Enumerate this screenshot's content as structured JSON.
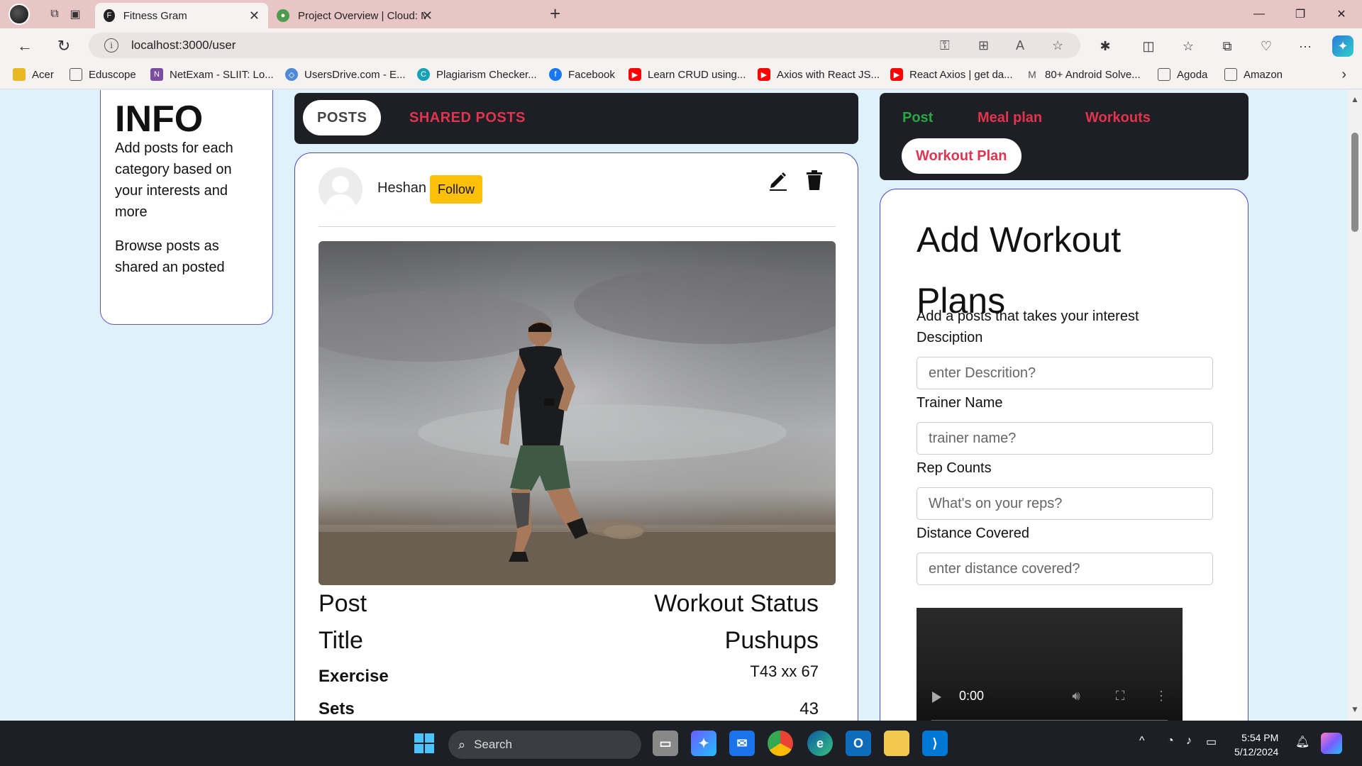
{
  "browser": {
    "tabs": [
      {
        "title": "Fitness Gram",
        "active": true
      },
      {
        "title": "Project Overview | Cloud: Mongo",
        "active": false
      }
    ],
    "url": "localhost:3000/user",
    "bookmarks": [
      {
        "label": "Acer",
        "icon": "folder-icon",
        "color": "#e8b923"
      },
      {
        "label": "Eduscope",
        "icon": "page-icon",
        "color": "#555555"
      },
      {
        "label": "NetExam - SLIIT: Lo...",
        "icon": "netexam-icon",
        "color": "#7b4ea3"
      },
      {
        "label": "UsersDrive.com - E...",
        "icon": "usersdrive-icon",
        "color": "#4e8ad8"
      },
      {
        "label": "Plagiarism Checker...",
        "icon": "plagiarism-icon",
        "color": "#17a2b8"
      },
      {
        "label": "Facebook",
        "icon": "facebook-icon",
        "color": "#1877f2"
      },
      {
        "label": "Learn CRUD using...",
        "icon": "youtube-icon",
        "color": "#ff0000"
      },
      {
        "label": "Axios with React JS...",
        "icon": "youtube-icon",
        "color": "#ff0000"
      },
      {
        "label": "React Axios | get da...",
        "icon": "youtube-icon",
        "color": "#ff0000"
      },
      {
        "label": "80+ Android Solve...",
        "icon": "gmail-icon",
        "color": "#555555"
      },
      {
        "label": "Agoda",
        "icon": "page-icon",
        "color": "#555555"
      },
      {
        "label": "Amazon",
        "icon": "page-icon",
        "color": "#555555"
      }
    ]
  },
  "info": {
    "title": "INFO",
    "p1": "Add posts for each category based on your interests and more",
    "p2": "Browse posts as shared an posted"
  },
  "center_tabs": {
    "posts": "POSTS",
    "shared": "SHARED POSTS"
  },
  "post": {
    "author": "Heshan",
    "follow": "Follow",
    "rows": [
      {
        "left": "Post",
        "right": "Workout Status"
      },
      {
        "left": "Title",
        "right": "Pushups"
      },
      {
        "left": "Exercise",
        "right": "T43 xx 67"
      },
      {
        "left": "Sets",
        "right": "43"
      }
    ]
  },
  "right_tabs": {
    "post": "Post",
    "meal": "Meal plan",
    "workouts": "Workouts",
    "workout_plan": "Workout Plan"
  },
  "form": {
    "title": "Add Workout Plans",
    "subtitle": "Add a posts that takes your interest",
    "fields": [
      {
        "label": "Desciption",
        "placeholder": "enter Descrition?"
      },
      {
        "label": "Trainer Name",
        "placeholder": "trainer name?"
      },
      {
        "label": "Rep Counts",
        "placeholder": "What's on your reps?"
      },
      {
        "label": "Distance Covered",
        "placeholder": "enter distance covered?"
      }
    ],
    "video_time": "0:00"
  },
  "taskbar": {
    "search": "Search",
    "time": "5:54 PM",
    "date": "5/12/2024"
  },
  "colors": {
    "accent_red": "#e2334f",
    "accent_green": "#28a745",
    "follow_yellow": "#ffc107",
    "card_border": "#4a45d8",
    "dark_bar": "#1d1f24"
  }
}
